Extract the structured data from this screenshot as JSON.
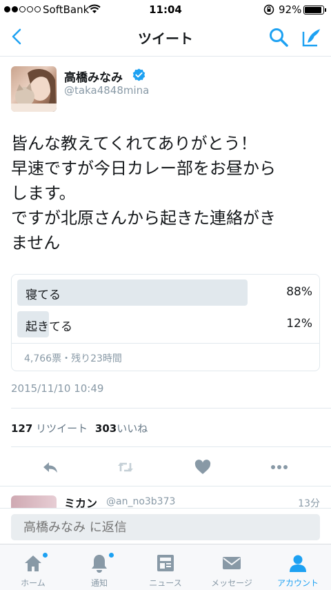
{
  "status_bar": {
    "carrier": "SoftBank",
    "time": "11:04",
    "battery_percent": "92%",
    "battery_level": 0.92
  },
  "header": {
    "title": "ツイート"
  },
  "author": {
    "name": "高橋みなみ",
    "handle": "@taka4848mina"
  },
  "tweet": {
    "lines": [
      "皆んな教えてくれてありがとう！",
      "早速ですが今日カレー部をお昼から",
      "します。",
      "ですが北原さんから起きた連絡がき",
      "ません"
    ]
  },
  "poll": {
    "options": [
      {
        "label": "寝てる",
        "percent_text": "88%",
        "fraction": 0.88
      },
      {
        "label": "起きてる",
        "percent_text": "12%",
        "fraction": 0.12
      }
    ],
    "meta": "4,766票・残り23時間"
  },
  "timestamp": "2015/11/10 10:49",
  "counts": {
    "retweets": "127",
    "retweets_label": "リツイート",
    "likes": "303",
    "likes_label": "いいね"
  },
  "reply_preview": {
    "name": "ミカン",
    "handle": "@an_no3b373",
    "time": "13分"
  },
  "reply_bar": {
    "placeholder": "高橋みなみ に返信"
  },
  "tabs": [
    {
      "label": "ホーム",
      "icon": "home-icon",
      "badge": true
    },
    {
      "label": "通知",
      "icon": "bell-icon",
      "badge": true
    },
    {
      "label": "ニュース",
      "icon": "news-icon",
      "badge": false
    },
    {
      "label": "メッセージ",
      "icon": "envelope-icon",
      "badge": false
    },
    {
      "label": "アカウント",
      "icon": "person-icon",
      "badge": false,
      "active": true
    }
  ],
  "colors": {
    "accent": "#1da1f2",
    "muted": "#8899a6",
    "poll_bar": "#e1e8ed"
  }
}
